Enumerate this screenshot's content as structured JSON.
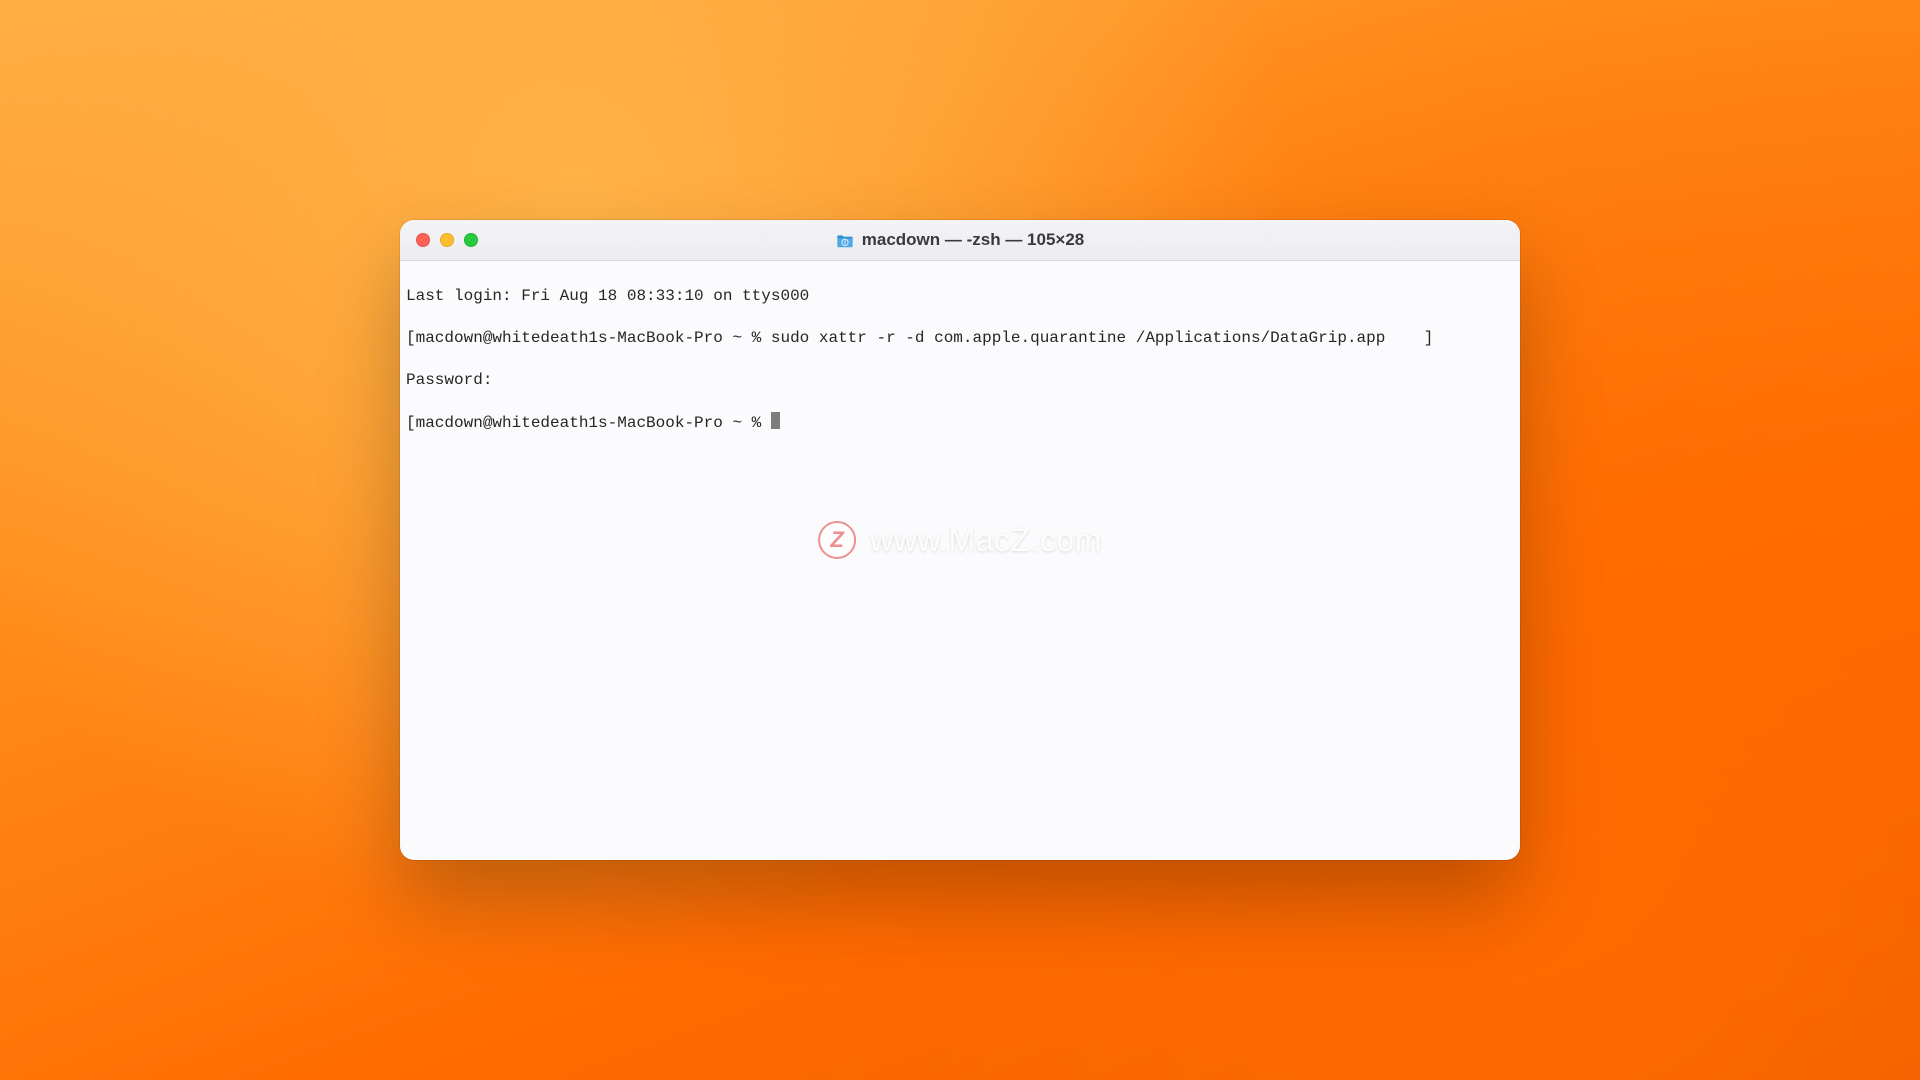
{
  "window": {
    "title": "macdown — -zsh — 105×28"
  },
  "terminal": {
    "lines": {
      "last_login": "Last login: Fri Aug 18 08:33:10 on ttys000",
      "prompt1": "[macdown@whitedeath1s-MacBook-Pro ~ % sudo xattr -r -d com.apple.quarantine /Applications/DataGrip.app    ]",
      "password": "Password:",
      "prompt2_left": "[macdown@whitedeath1s-MacBook-Pro ~ % "
    }
  },
  "watermark": {
    "badge": "Z",
    "text": "www.MacZ.com"
  }
}
